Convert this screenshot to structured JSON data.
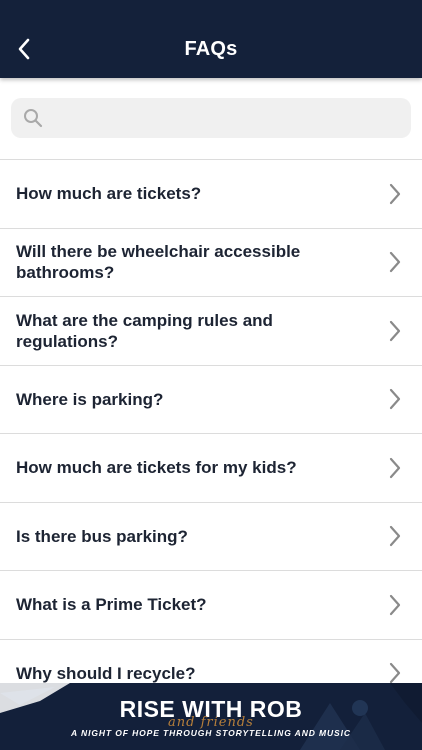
{
  "header": {
    "title": "FAQs",
    "back_icon": "chevron-left-icon",
    "background": "#14213a"
  },
  "search": {
    "placeholder": "",
    "value": "",
    "icon": "search-icon"
  },
  "faqs": [
    {
      "question": "How much are tickets?"
    },
    {
      "question": "Will there be wheelchair accessible bathrooms?"
    },
    {
      "question": "What are the camping rules and regulations?"
    },
    {
      "question": "Where is parking?"
    },
    {
      "question": "How much are tickets for my kids?"
    },
    {
      "question": "Is there bus parking?"
    },
    {
      "question": "What is a Prime Ticket?"
    },
    {
      "question": "Why should I recycle?"
    }
  ],
  "banner": {
    "title": "RISE WITH ROB",
    "script": "and friends",
    "subtitle": "A NIGHT OF HOPE THROUGH STORYTELLING AND MUSIC",
    "background": "#13203a",
    "accent": "#c98a3a"
  }
}
